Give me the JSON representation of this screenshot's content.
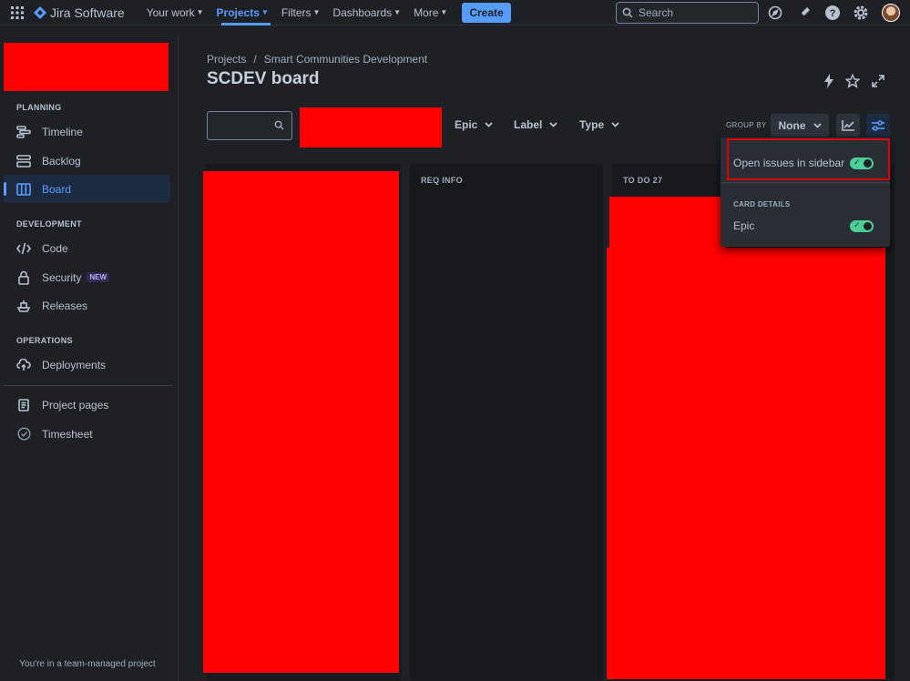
{
  "topnav": {
    "logo_text": "Jira Software",
    "items": [
      {
        "label": "Your work",
        "active": false
      },
      {
        "label": "Projects",
        "active": true
      },
      {
        "label": "Filters",
        "active": false
      },
      {
        "label": "Dashboards",
        "active": false
      },
      {
        "label": "More",
        "active": false
      }
    ],
    "create_label": "Create",
    "search_placeholder": "Search"
  },
  "sidebar": {
    "sections": {
      "planning": "PLANNING",
      "development": "DEVELOPMENT",
      "operations": "OPERATIONS"
    },
    "items": {
      "timeline": "Timeline",
      "backlog": "Backlog",
      "board": "Board",
      "code": "Code",
      "security": "Security",
      "security_badge": "NEW",
      "releases": "Releases",
      "deployments": "Deployments",
      "project_pages": "Project pages",
      "timesheet": "Timesheet"
    },
    "active_item": "board",
    "footer_note": "You're in a team-managed project"
  },
  "main": {
    "breadcrumb": [
      "Projects",
      "Smart Communities Development"
    ],
    "title": "SCDEV board",
    "filters": {
      "epic": "Epic",
      "label": "Label",
      "type": "Type",
      "group_by_label": "GROUP BY",
      "group_by_value": "None"
    },
    "columns": [
      {
        "title": ""
      },
      {
        "title": "REQ INFO"
      },
      {
        "title": "TO DO 27"
      }
    ]
  },
  "view_settings": {
    "open_in_sidebar_label": "Open issues in sidebar",
    "open_in_sidebar_enabled": true,
    "card_details_title": "CARD DETAILS",
    "epic_label": "Epic",
    "epic_enabled": true
  },
  "colors": {
    "accent": "#579dff",
    "toggle_on": "#4bce97",
    "background": "#1d2125",
    "redaction": "#ff0000"
  }
}
